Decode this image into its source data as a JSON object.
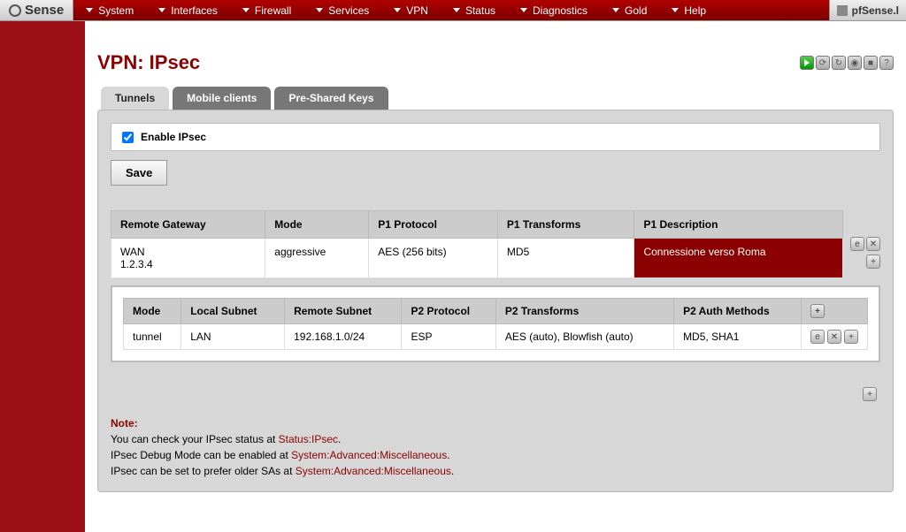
{
  "brand": "Sense",
  "right_brand": "pfSense.l",
  "nav": [
    "System",
    "Interfaces",
    "Firewall",
    "Services",
    "VPN",
    "Status",
    "Diagnostics",
    "Gold",
    "Help"
  ],
  "page_title": "VPN: IPsec",
  "tabs": {
    "tunnels": "Tunnels",
    "mobile": "Mobile clients",
    "psk": "Pre-Shared Keys"
  },
  "enable_label": "Enable IPsec",
  "enable_checked": true,
  "save_label": "Save",
  "p1": {
    "headers": {
      "gateway": "Remote Gateway",
      "mode": "Mode",
      "proto": "P1 Protocol",
      "trans": "P1 Transforms",
      "desc": "P1 Description"
    },
    "row": {
      "if": "WAN",
      "ip": "1.2.3.4",
      "mode": "aggressive",
      "proto": "AES (256 bits)",
      "trans": "MD5",
      "desc": "Connessione verso Roma"
    }
  },
  "p2": {
    "headers": {
      "mode": "Mode",
      "local": "Local Subnet",
      "remote": "Remote Subnet",
      "proto": "P2 Protocol",
      "trans": "P2 Transforms",
      "auth": "P2 Auth Methods"
    },
    "row": {
      "mode": "tunnel",
      "local": "LAN",
      "remote": "192.168.1.0/24",
      "proto": "ESP",
      "trans": "AES (auto), Blowfish (auto)",
      "auth": "MD5, SHA1"
    }
  },
  "note": {
    "hdr": "Note:",
    "l1a": "You can check your IPsec status at ",
    "l1b": "Status:IPsec",
    "l2a": "IPsec Debug Mode can be enabled at ",
    "l2b": "System:Advanced:Miscellaneous",
    "l3a": "IPsec can be set to prefer older SAs at ",
    "l3b": "System:Advanced:Miscellaneous"
  }
}
